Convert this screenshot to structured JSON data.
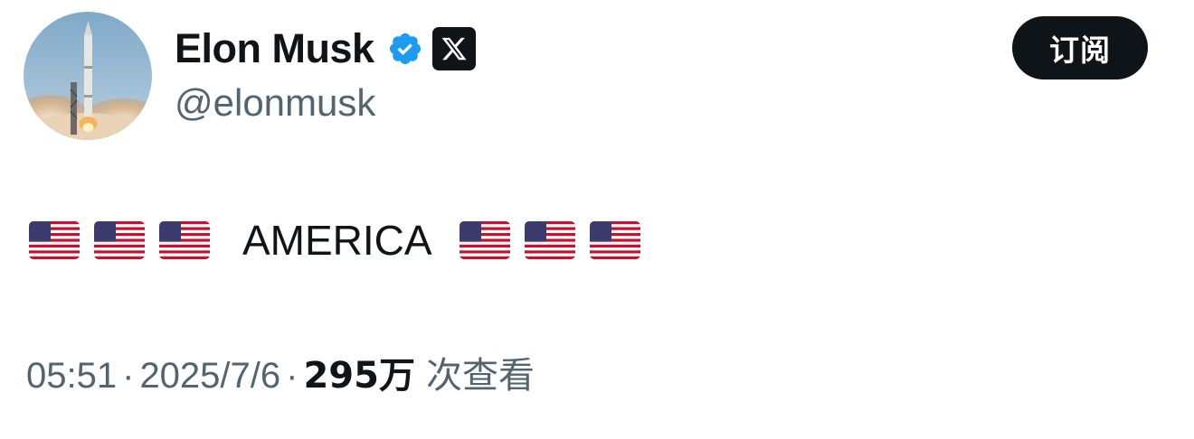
{
  "author": {
    "display_name": "Elon Musk",
    "handle": "@elonmusk",
    "avatar_icon": "rocket-launch-avatar",
    "verified_icon": "verified-badge-icon",
    "affiliate_icon": "x-logo-icon",
    "verified_color": "#1d9bf0"
  },
  "actions": {
    "subscribe_label": "订阅"
  },
  "tweet": {
    "text": "AMERICA",
    "flags_before": [
      "us-flag",
      "us-flag",
      "us-flag"
    ],
    "flags_after": [
      "us-flag",
      "us-flag",
      "us-flag"
    ]
  },
  "meta": {
    "time": "05:51",
    "separator": "·",
    "date": "2025/7/6",
    "views_count": "295万",
    "views_label": "次查看"
  },
  "colors": {
    "text_primary": "#0f1419",
    "text_secondary": "#536471",
    "button_bg": "#0f1419"
  }
}
